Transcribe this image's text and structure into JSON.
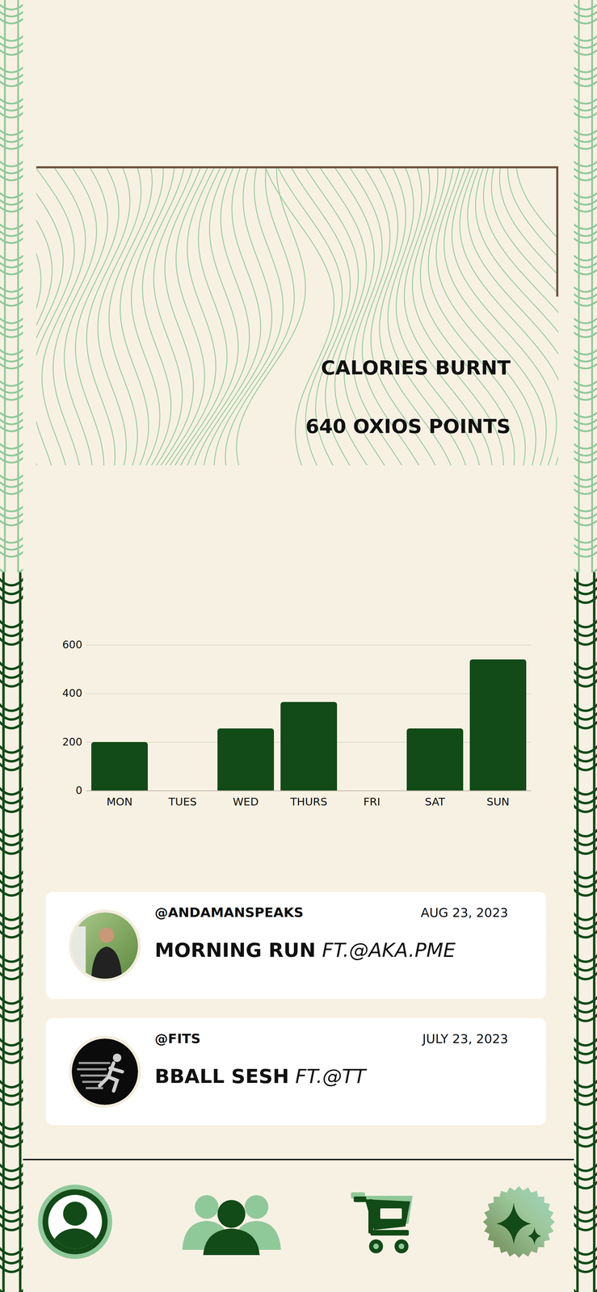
{
  "summary": {
    "title": "CALORIES BURNT",
    "value": "640 OXIOS POINTS"
  },
  "chart": {
    "ticks": [
      "600",
      "400",
      "200",
      "0"
    ],
    "categories": [
      "MON",
      "TUES",
      "WED",
      "THURS",
      "FRI",
      "SAT",
      "SUN"
    ],
    "series": [
      {
        "values": [
          200,
          0,
          255,
          365,
          0,
          255,
          540
        ]
      }
    ]
  },
  "activities": [
    {
      "user": "@ANDAMANSPEAKS",
      "date": "AUG 23, 2023",
      "title": "MORNING RUN",
      "featuring": "FT.@AKA.PME",
      "kind": "photo"
    },
    {
      "user": "@FITS",
      "date": "JULY 23, 2023",
      "title": "BBALL SESH",
      "featuring": "FT.@TT",
      "kind": "logo"
    }
  ]
}
